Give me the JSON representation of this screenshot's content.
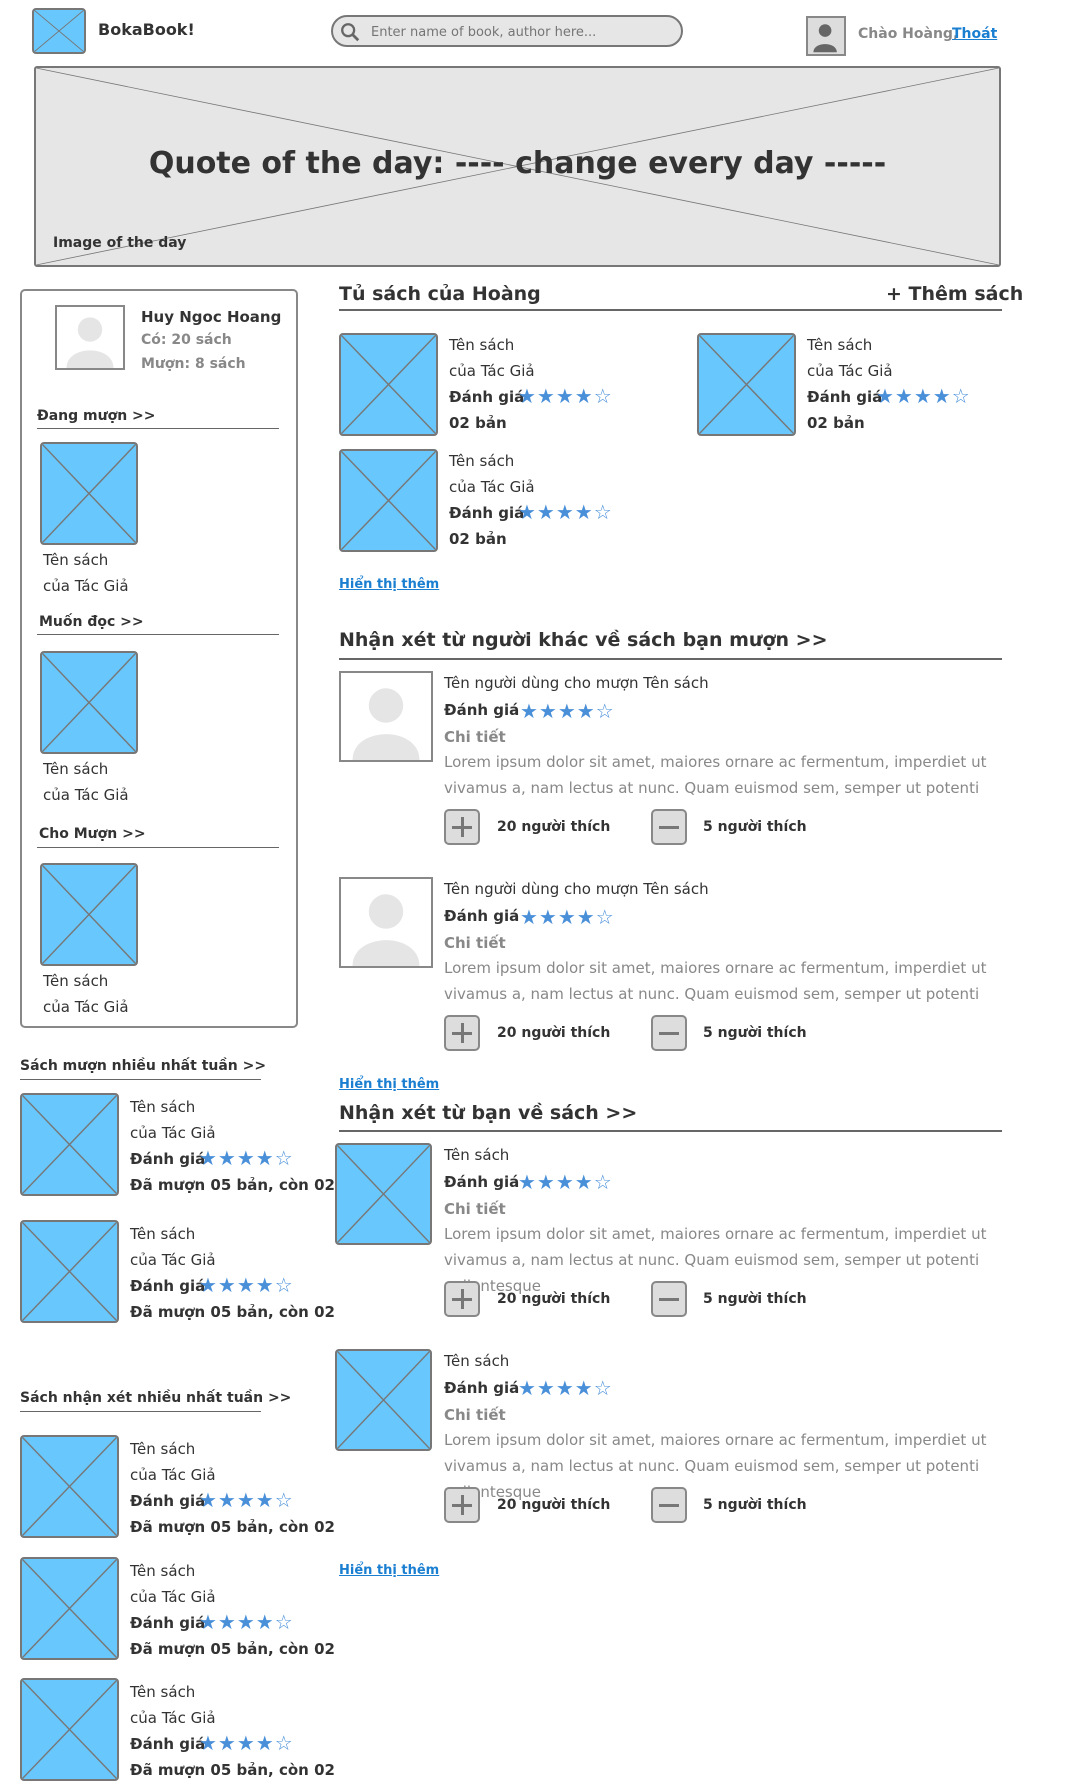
{
  "header": {
    "brand": "BokaBook!",
    "search_placeholder": "Enter name of book, author here...",
    "greeting": "Chào Hoàng,",
    "logout": "Thoát"
  },
  "banner": {
    "quote": "Quote of the day: ---- change every day -----",
    "caption": "Image of the day"
  },
  "profile": {
    "name": "Huy Ngoc Hoang",
    "owned": "Có: 20 sách",
    "borrowed": "Mượn: 8 sách",
    "sections": [
      {
        "title": "Đang mượn >>",
        "book_title": "Tên sách",
        "book_author": "của Tác Giả"
      },
      {
        "title": "Muốn đọc >>",
        "book_title": "Tên sách",
        "book_author": "của Tác Giả"
      },
      {
        "title": "Cho Mượn >>",
        "book_title": "Tên sách",
        "book_author": "của Tác Giả"
      }
    ]
  },
  "top_borrowed": {
    "title": "Sách mượn nhiều nhất tuần >>",
    "items": [
      {
        "title": "Tên sách",
        "author": "của Tác Giả",
        "rating_label": "Đánh giá",
        "rating": 4,
        "status": "Đã mượn 05 bản, còn 02"
      },
      {
        "title": "Tên sách",
        "author": "của Tác Giả",
        "rating_label": "Đánh giá",
        "rating": 4,
        "status": "Đã mượn 05 bản, còn 02"
      }
    ]
  },
  "top_reviewed": {
    "title": "Sách nhận xét nhiều nhất tuần >>",
    "items": [
      {
        "title": "Tên sách",
        "author": "của Tác Giả",
        "rating_label": "Đánh giá",
        "rating": 4,
        "status": "Đã mượn 05 bản, còn 02"
      },
      {
        "title": "Tên sách",
        "author": "của Tác Giả",
        "rating_label": "Đánh giá",
        "rating": 4,
        "status": "Đã mượn 05 bản, còn 02"
      },
      {
        "title": "Tên sách",
        "author": "của Tác Giả",
        "rating_label": "Đánh giá",
        "rating": 4,
        "status": "Đã mượn 05 bản, còn 02"
      }
    ]
  },
  "bookshelf": {
    "title": "Tủ sách của Hoàng",
    "add_button": "+ Thêm sách",
    "more": "Hiển thị thêm",
    "books": [
      {
        "title": "Tên sách",
        "author": "của Tác Giả",
        "rating_label": "Đánh giá",
        "rating": 4,
        "copies": "02 bản"
      },
      {
        "title": "Tên sách",
        "author": "của Tác Giả",
        "rating_label": "Đánh giá",
        "rating": 4,
        "copies": "02 bản"
      },
      {
        "title": "Tên sách",
        "author": "của Tác Giả",
        "rating_label": "Đánh giá",
        "rating": 4,
        "copies": "02 bản"
      }
    ]
  },
  "others_reviews": {
    "title": "Nhận xét từ người khác về sách bạn mượn >>",
    "more": "Hiển thị thêm",
    "items": [
      {
        "header": "Tên người dùng cho mượn  Tên sách",
        "rating_label": "Đánh giá",
        "rating": 4,
        "detail": "Chi tiết",
        "body": "Lorem ipsum dolor sit amet, maiores ornare ac fermentum, imperdiet ut vivamus a, nam lectus at nunc. Quam euismod sem, semper ut potenti",
        "likes": "20 người thích",
        "dislikes": "5 người thích"
      },
      {
        "header": "Tên người dùng cho mượn  Tên sách",
        "rating_label": "Đánh giá",
        "rating": 4,
        "detail": "Chi tiết",
        "body": "Lorem ipsum dolor sit amet, maiores ornare ac fermentum, imperdiet ut vivamus a, nam lectus at nunc. Quam euismod sem, semper ut potenti",
        "likes": "20 người thích",
        "dislikes": "5 người thích"
      }
    ]
  },
  "friend_reviews": {
    "title": "Nhận xét từ bạn về sách >>",
    "more": "Hiển thị thêm",
    "items": [
      {
        "header": "Tên sách",
        "rating_label": "Đánh giá",
        "rating": 4,
        "detail": "Chi tiết",
        "body": "Lorem ipsum dolor sit amet, maiores ornare ac fermentum, imperdiet ut vivamus a, nam lectus at nunc. Quam euismod sem, semper ut potenti pellentesque",
        "likes": "20 người thích",
        "dislikes": "5 người thích"
      },
      {
        "header": "Tên sách",
        "rating_label": "Đánh giá",
        "rating": 4,
        "detail": "Chi tiết",
        "body": "Lorem ipsum dolor sit amet, maiores ornare ac fermentum, imperdiet ut vivamus a, nam lectus at nunc. Quam euismod sem, semper ut potenti pellentesque",
        "likes": "20 người thích",
        "dislikes": "5 người thích"
      }
    ]
  },
  "colors": {
    "placeholder_fill": "#68c8fe",
    "star": "#4a90d9",
    "link": "#1a7fd1"
  }
}
